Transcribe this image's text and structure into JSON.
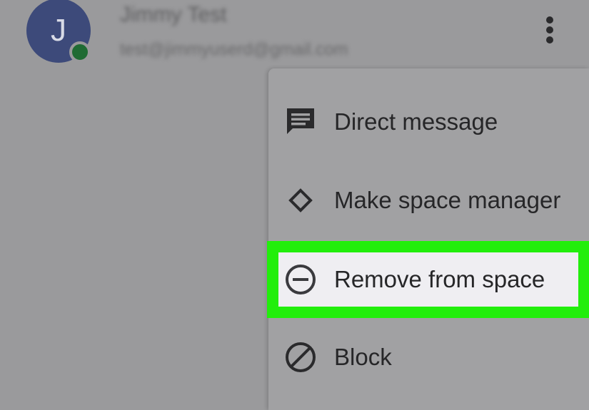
{
  "member": {
    "initial": "J",
    "name": "Jimmy Test",
    "email": "test@jimmyuserd@gmail.com"
  },
  "overflow_icon": "more-vert-icon",
  "menu": {
    "items": [
      {
        "label": "Direct message",
        "icon": "chat-bubble-icon"
      },
      {
        "label": "Make space manager",
        "icon": "diamond-icon"
      },
      {
        "label": "Remove from space",
        "icon": "remove-circle-icon",
        "highlighted": true
      },
      {
        "label": "Block",
        "icon": "block-icon"
      }
    ]
  },
  "colors": {
    "avatar": "#3d4a7a",
    "presence": "#1f6b33",
    "highlight": "#22ee0c",
    "selected_item_bg": "#efeef2",
    "scrim": "#9a9a9c"
  }
}
